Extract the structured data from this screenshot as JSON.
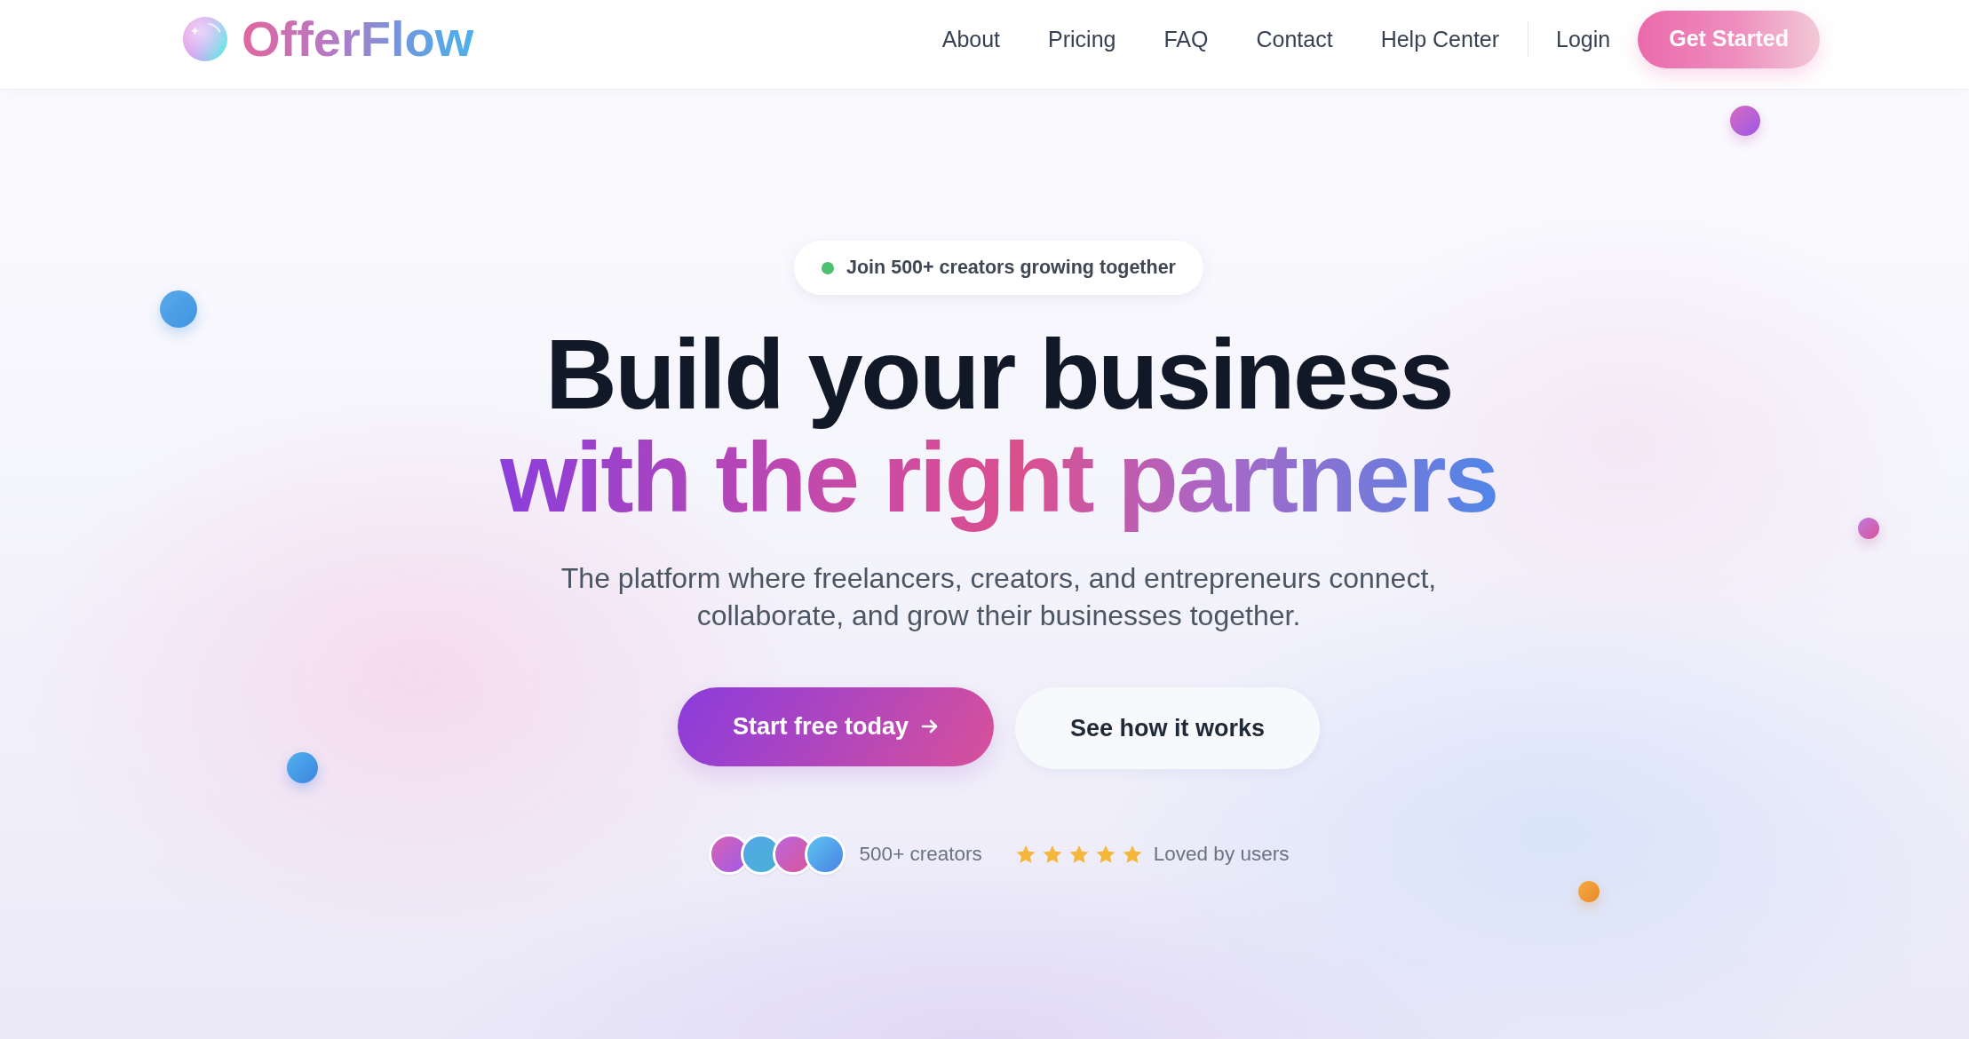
{
  "nav": {
    "logo": "OfferFlow",
    "links": [
      "About",
      "Pricing",
      "FAQ",
      "Contact",
      "Help Center"
    ],
    "login": "Login",
    "cta": "Get Started"
  },
  "hero": {
    "badge": "Join 500+ creators growing together",
    "title": {
      "line_1": "Build your business",
      "line_2": "with the right partners"
    },
    "subtitle": "The platform where freelancers, creators, and entrepreneurs connect, collaborate, and grow their businesses together.",
    "buttons": [
      {
        "label": "Start free today",
        "kind": "primary"
      },
      {
        "label": "See how it works",
        "kind": "secondary"
      }
    ],
    "social_proof": {
      "creators": "500+ creators",
      "rating": {
        "stars": 5,
        "label": "Loved by users"
      }
    }
  }
}
